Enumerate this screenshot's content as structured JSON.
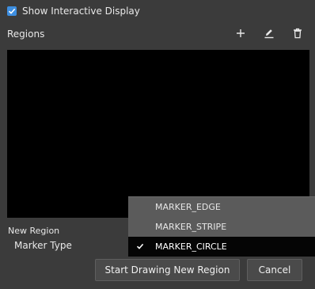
{
  "interactive_display": {
    "label": "Show Interactive Display",
    "checked": true
  },
  "regions": {
    "title": "Regions",
    "toolbar": {
      "add_icon": "plus-icon",
      "edit_icon": "pencil-icon",
      "delete_icon": "trash-icon"
    },
    "items": []
  },
  "new_region": {
    "title": "New Region",
    "marker_type_label": "Marker Type",
    "marker_options": [
      "MARKER_EDGE",
      "MARKER_STRIPE",
      "MARKER_CIRCLE"
    ],
    "selected_marker": "MARKER_CIRCLE"
  },
  "actions": {
    "start_label": "Start Drawing New Region",
    "cancel_label": "Cancel"
  },
  "colors": {
    "background": "#3b3b3b",
    "checkbox": "#3d8ee0",
    "list_background": "#000000",
    "dropdown": "#5b5b5b",
    "selected_option": "#050505"
  }
}
